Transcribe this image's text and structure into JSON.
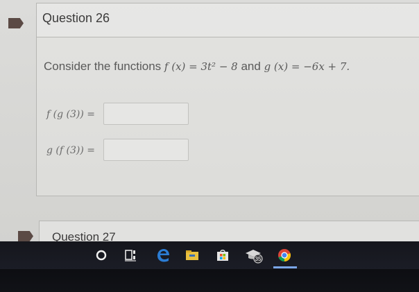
{
  "questions": [
    {
      "title": "Question 26",
      "prompt": {
        "lead": "Consider the functions",
        "f_def": "f (x) = 3t² − 8",
        "connector": "and",
        "g_def": "g (x) = −6x + 7."
      },
      "answers": [
        {
          "label": "f (g (3)) =",
          "value": "",
          "placeholder": ""
        },
        {
          "label": "g (f (3)) =",
          "value": "",
          "placeholder": ""
        }
      ]
    },
    {
      "title": "Question 27"
    }
  ],
  "taskbar": {
    "items": [
      {
        "icon": "cortana-circle-icon"
      },
      {
        "icon": "task-view-icon"
      },
      {
        "icon": "edge-browser-icon"
      },
      {
        "icon": "file-explorer-icon"
      },
      {
        "icon": "microsoft-store-icon"
      },
      {
        "icon": "notification-app-icon",
        "badge": "35"
      },
      {
        "icon": "chrome-icon",
        "running": true
      }
    ]
  },
  "colors": {
    "flag": "#5b4a45",
    "taskbar": "#17181f",
    "running_indicator": "#7aa6e8",
    "edge_blue": "#2b7cd3",
    "explorer_yellow": "#e8c040"
  }
}
